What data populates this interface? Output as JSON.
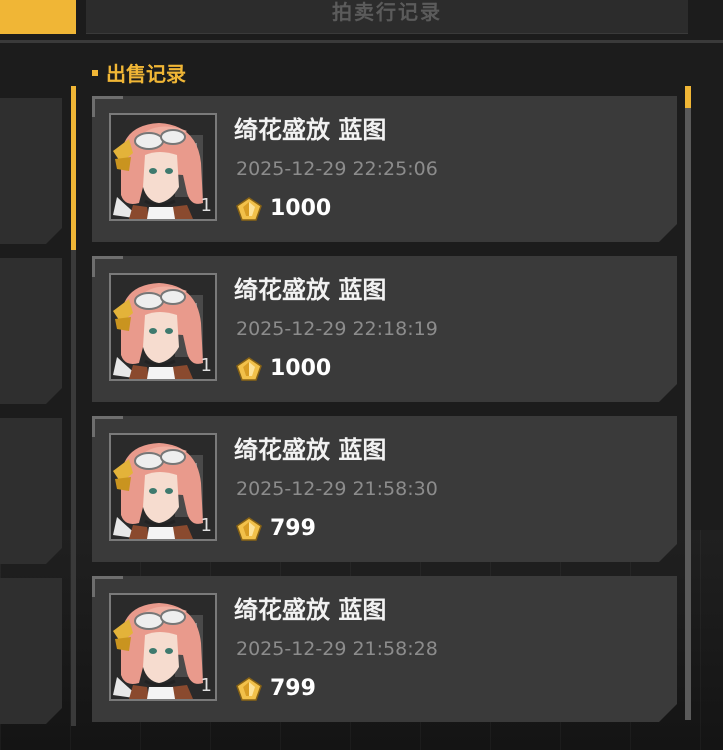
{
  "header": {
    "tab_title": "拍卖行记录"
  },
  "section": {
    "title": "出售记录"
  },
  "colors": {
    "accent": "#f0b636",
    "card_bg": "#3a3a3a",
    "page_bg": "#1c1c1c"
  },
  "records": [
    {
      "item_name": "绮花盛放 蓝图",
      "time": "2025-12-29 22:25:06",
      "price": "1000",
      "quantity": "1",
      "avatar_icon": "pink-hair-character-portrait",
      "currency_icon": "gold-crystal-icon"
    },
    {
      "item_name": "绮花盛放 蓝图",
      "time": "2025-12-29 22:18:19",
      "price": "1000",
      "quantity": "1",
      "avatar_icon": "pink-hair-character-portrait",
      "currency_icon": "gold-crystal-icon"
    },
    {
      "item_name": "绮花盛放 蓝图",
      "time": "2025-12-29 21:58:30",
      "price": "799",
      "quantity": "1",
      "avatar_icon": "pink-hair-character-portrait",
      "currency_icon": "gold-crystal-icon"
    },
    {
      "item_name": "绮花盛放 蓝图",
      "time": "2025-12-29 21:58:28",
      "price": "799",
      "quantity": "1",
      "avatar_icon": "pink-hair-character-portrait",
      "currency_icon": "gold-crystal-icon"
    }
  ]
}
